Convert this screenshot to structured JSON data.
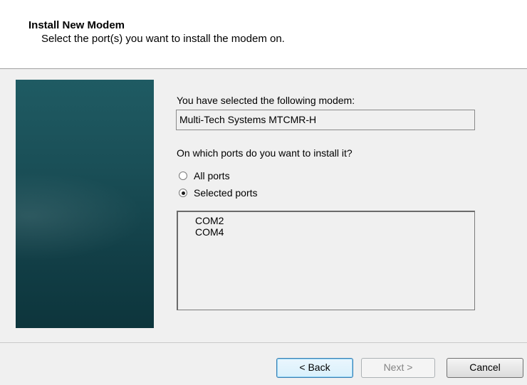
{
  "header": {
    "title": "Install New Modem",
    "subtitle": "Select the port(s) you want to install the modem on."
  },
  "content": {
    "selected_modem_label": "You have selected the following modem:",
    "selected_modem_value": "Multi-Tech Systems MTCMR-H",
    "ports_question": "On which ports do you want to install it?",
    "radio_all_ports": {
      "label": "All ports",
      "checked": false
    },
    "radio_selected_ports": {
      "label": "Selected ports",
      "checked": true
    },
    "port_list": [
      "COM2",
      "COM4"
    ]
  },
  "buttons": {
    "back": "< Back",
    "next": "Next >",
    "cancel": "Cancel"
  },
  "colors": {
    "side_panel": "#1a4f57",
    "background": "#f0f0f0"
  }
}
